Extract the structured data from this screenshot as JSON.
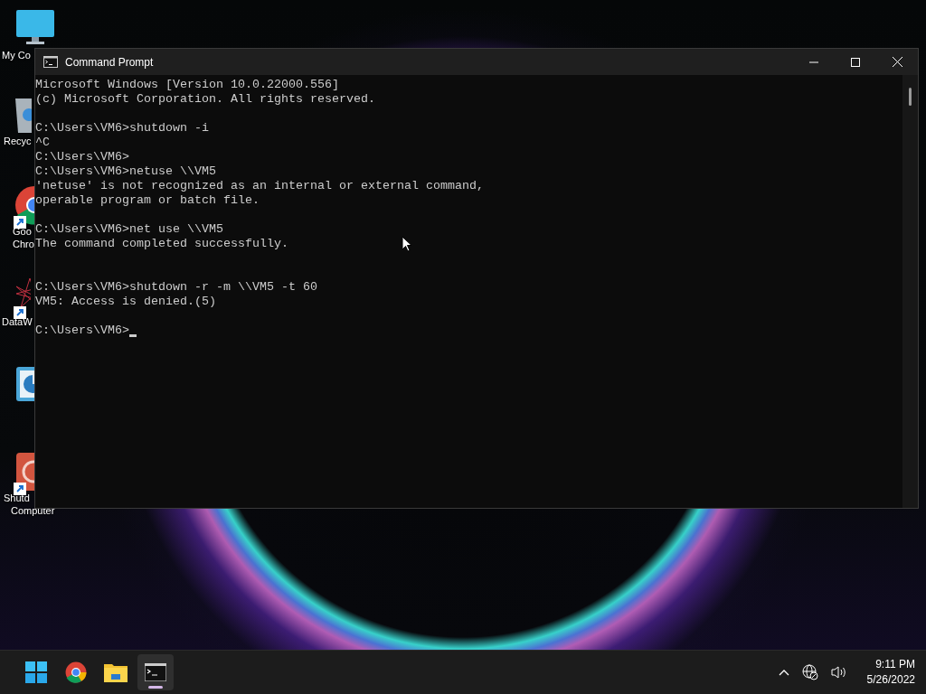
{
  "desktop_icons": [
    {
      "kind": "monitor",
      "label_lines": [
        "My Co"
      ]
    },
    {
      "kind": "bin",
      "label_lines": [
        "Recyc"
      ]
    },
    {
      "kind": "chrome",
      "label_lines": [
        "Goo",
        "Chro"
      ],
      "shortcut": true
    },
    {
      "kind": "datawave",
      "label_lines": [
        "DataW"
      ],
      "shortcut": true
    },
    {
      "kind": "chart"
    },
    {
      "kind": "power",
      "label_lines": [
        "Shutd",
        "Computer"
      ],
      "shortcut": true
    }
  ],
  "window": {
    "title": "Command Prompt",
    "console": [
      {
        "kind": "line",
        "text": "Microsoft Windows [Version 10.0.22000.556]"
      },
      {
        "kind": "line",
        "text": "(c) Microsoft Corporation. All rights reserved."
      },
      {
        "kind": "blank"
      },
      {
        "kind": "line",
        "text": "C:\\Users\\VM6>shutdown -i"
      },
      {
        "kind": "line",
        "text": "^C"
      },
      {
        "kind": "line",
        "text": "C:\\Users\\VM6>"
      },
      {
        "kind": "line",
        "text": "C:\\Users\\VM6>netuse \\\\VM5"
      },
      {
        "kind": "line",
        "text": "'netuse' is not recognized as an internal or external command,"
      },
      {
        "kind": "line",
        "text": "operable program or batch file."
      },
      {
        "kind": "blank"
      },
      {
        "kind": "line",
        "text": "C:\\Users\\VM6>net use \\\\VM5"
      },
      {
        "kind": "line",
        "text": "The command completed successfully."
      },
      {
        "kind": "blank"
      },
      {
        "kind": "blank"
      },
      {
        "kind": "line",
        "text": "C:\\Users\\VM6>shutdown -r -m \\\\VM5 -t 60"
      },
      {
        "kind": "line",
        "text": "VM5: Access is denied.(5)"
      },
      {
        "kind": "blank"
      },
      {
        "kind": "line",
        "text": "C:\\Users\\VM6>",
        "cursor": true
      }
    ]
  },
  "taskbar": {
    "apps": [
      {
        "kind": "start",
        "selected": false
      },
      {
        "kind": "chrome",
        "selected": false
      },
      {
        "kind": "folder",
        "selected": false
      },
      {
        "kind": "terminal",
        "selected": true
      }
    ],
    "time": "9:11 PM",
    "date": "5/26/2022"
  }
}
